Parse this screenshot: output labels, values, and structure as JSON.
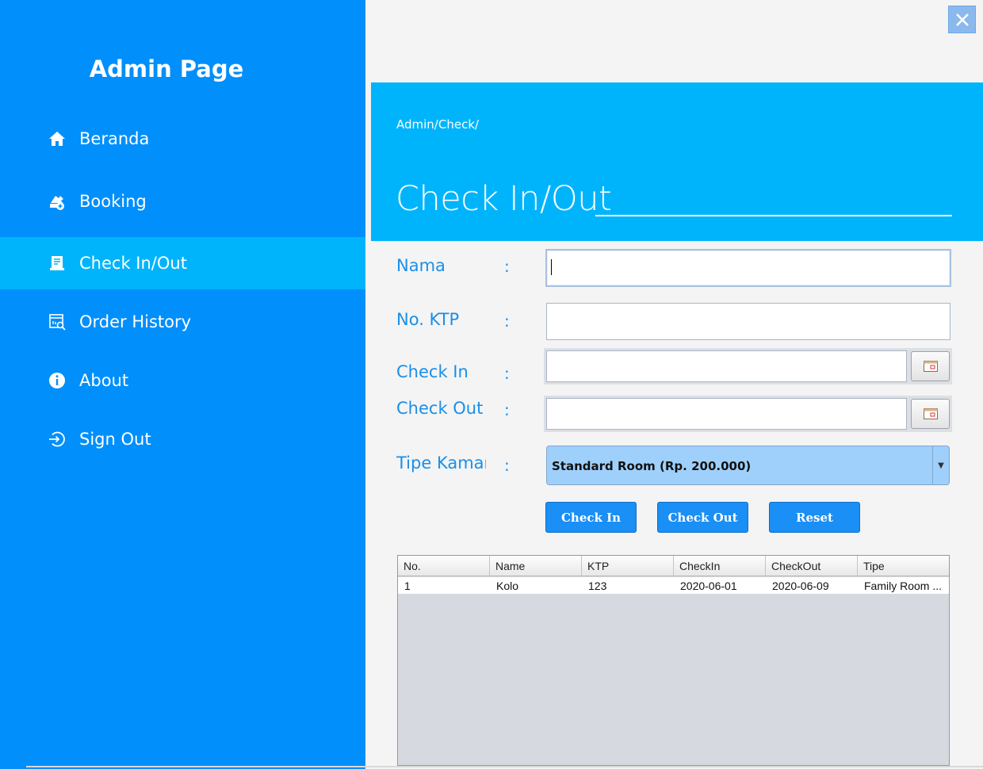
{
  "sidebar": {
    "title": "Admin Page",
    "items": [
      {
        "label": "Beranda",
        "icon": "home-icon"
      },
      {
        "label": "Booking",
        "icon": "booking-icon"
      },
      {
        "label": "Check In/Out",
        "icon": "checkinout-icon",
        "active": true
      },
      {
        "label": "Order History",
        "icon": "order-history-icon"
      },
      {
        "label": "About",
        "icon": "info-icon"
      },
      {
        "label": "Sign Out",
        "icon": "sign-out-icon"
      }
    ]
  },
  "header": {
    "breadcrumb": "Admin/Check/",
    "title": "Check In/Out"
  },
  "form": {
    "nama": {
      "label": "Nama",
      "colon": ":",
      "value": ""
    },
    "ktp": {
      "label": "No. KTP",
      "colon": ":",
      "value": ""
    },
    "check_in": {
      "label": "Check In",
      "colon": ":",
      "value": ""
    },
    "check_out": {
      "label": "Check Out",
      "colon": ":",
      "value": ""
    },
    "tipe_kamar": {
      "label": "Tipe Kamar",
      "colon": ":",
      "selected": "Standard Room (Rp. 200.000)"
    }
  },
  "buttons": {
    "check_in": "Check In",
    "check_out": "Check Out",
    "reset": "Reset"
  },
  "table": {
    "headers": [
      "No.",
      "Name",
      "KTP",
      "CheckIn",
      "CheckOut",
      "Tipe"
    ],
    "rows": [
      [
        "1",
        "Kolo",
        "123",
        "2020-06-01",
        "2020-06-09",
        "Family Room ..."
      ]
    ]
  },
  "colors": {
    "sidebar": "#008ffb",
    "sidebar_active": "#00b4fb",
    "banner": "#00b4fb",
    "label": "#1a8fe8",
    "button": "#1a8ff5",
    "select": "#9fd0fc"
  }
}
